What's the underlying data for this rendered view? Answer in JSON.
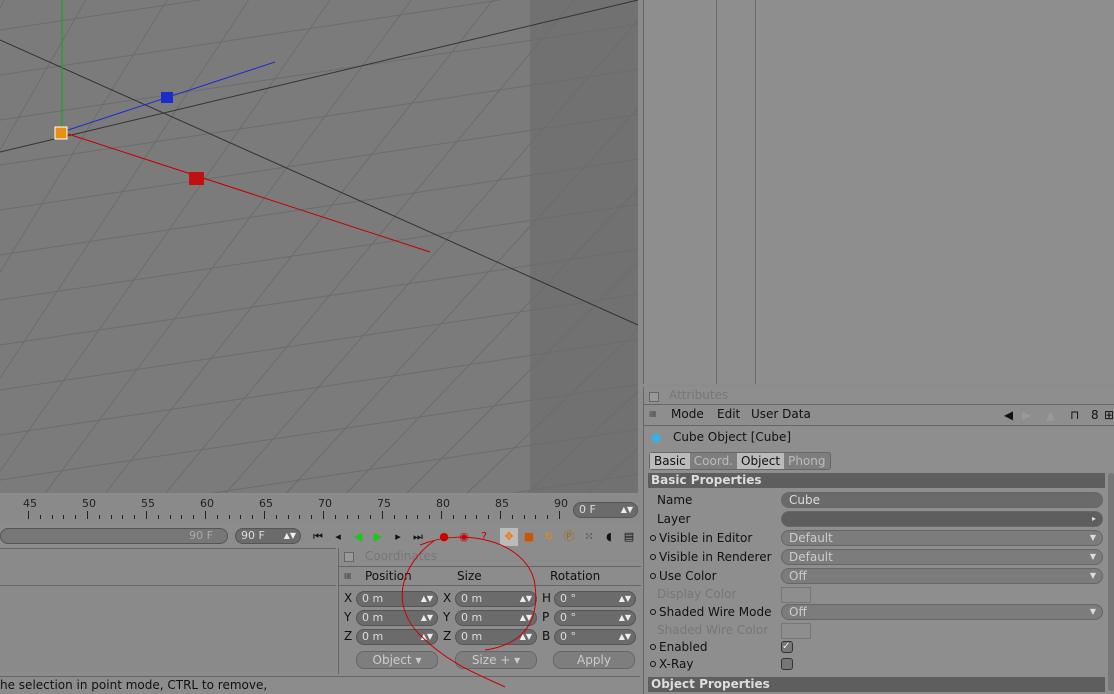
{
  "viewport": {
    "axis_colors": {
      "x": "#c00000",
      "y": "#00b000",
      "z": "#1a2dcc"
    }
  },
  "timeline": {
    "ticks": [
      "45",
      "50",
      "55",
      "60",
      "65",
      "70",
      "75",
      "80",
      "85",
      "90"
    ],
    "current_frame": "0 F",
    "end_frame_slider": "90 F",
    "end_frame": "90 F"
  },
  "transport": {
    "icons": [
      "first-frame-icon",
      "prev-key-icon",
      "play-backward-icon",
      "play-forward-icon",
      "next-key-icon",
      "last-frame-icon"
    ]
  },
  "coordinates": {
    "title": "Coordinates",
    "headers": {
      "position": "Position",
      "size": "Size",
      "rotation": "Rotation"
    },
    "rows": [
      {
        "pl": "X",
        "pv": "0 m",
        "sl": "X",
        "sv": "0 m",
        "rl": "H",
        "rv": "0 °"
      },
      {
        "pl": "Y",
        "pv": "0 m",
        "sl": "Y",
        "sv": "0 m",
        "rl": "P",
        "rv": "0 °"
      },
      {
        "pl": "Z",
        "pv": "0 m",
        "sl": "Z",
        "sv": "0 m",
        "rl": "B",
        "rv": "0 °"
      }
    ],
    "mode_select": "Object",
    "size_select": "Size +",
    "apply": "Apply"
  },
  "status": "he selection in point mode, CTRL to remove,",
  "attributes": {
    "title": "Attributes",
    "menu": [
      "Mode",
      "Edit",
      "User Data"
    ],
    "object_title": "Cube Object [Cube]",
    "tabs": [
      {
        "label": "Basic",
        "active": true
      },
      {
        "label": "Coord.",
        "active": false
      },
      {
        "label": "Object",
        "active": true
      },
      {
        "label": "Phong",
        "active": false
      }
    ],
    "section": "Basic Properties",
    "name_label": "Name",
    "name_value": "Cube",
    "layer_label": "Layer",
    "vis_editor_label": "Visible in Editor",
    "vis_editor_value": "Default",
    "vis_render_label": "Visible in Renderer",
    "vis_render_value": "Default",
    "use_color_label": "Use Color",
    "use_color_value": "Off",
    "display_color_label": "Display Color",
    "shaded_mode_label": "Shaded Wire Mode",
    "shaded_mode_value": "Off",
    "shaded_color_label": "Shaded Wire Color",
    "enabled_label": "Enabled",
    "enabled": true,
    "xray_label": "X-Ray",
    "xray": false,
    "section2": "Object Properties"
  }
}
